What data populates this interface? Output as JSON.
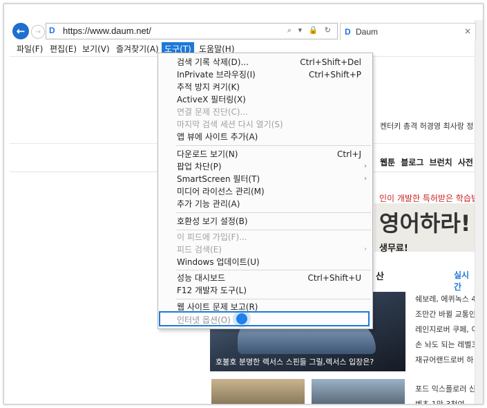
{
  "browser": {
    "url": "https://www.daum.net/",
    "tab_title": "Daum",
    "favicon_letter": "D",
    "url_icons": "⌕ ▾ 🔒 ↻",
    "close_glyph": "×"
  },
  "menubar": [
    {
      "label": "파일(F)"
    },
    {
      "label": "편집(E)"
    },
    {
      "label": "보기(V)"
    },
    {
      "label": "즐겨찾기(A)"
    },
    {
      "label": "도구(T)"
    },
    {
      "label": "도움말(H)"
    }
  ],
  "tools_menu": {
    "items": [
      {
        "label": "검색 기록 삭제(D)...",
        "shortcut": "Ctrl+Shift+Del"
      },
      {
        "label": "InPrivate 브라우징(I)",
        "shortcut": "Ctrl+Shift+P"
      },
      {
        "label": "추적 방지 켜기(K)",
        "shortcut": ""
      },
      {
        "label": "ActiveX 필터링(X)",
        "shortcut": ""
      },
      {
        "label": "연결 문제 진단(C)...",
        "shortcut": ""
      },
      {
        "label": "마지막 검색 세션 다시 열기(S)",
        "shortcut": ""
      },
      {
        "label": "앱 뷰에 사이트 추가(A)",
        "shortcut": ""
      },
      {
        "label": "다운로드 보기(N)",
        "shortcut": "Ctrl+J"
      },
      {
        "label": "팝업 차단(P)",
        "shortcut": ""
      },
      {
        "label": "SmartScreen 필터(T)",
        "shortcut": ""
      },
      {
        "label": "미디어 라이선스 관리(M)",
        "shortcut": ""
      },
      {
        "label": "추가 기능 관리(A)",
        "shortcut": ""
      },
      {
        "label": "호환성 보기 설정(B)",
        "shortcut": ""
      },
      {
        "label": "이 피드에 가입(F)...",
        "shortcut": ""
      },
      {
        "label": "피드 검색(E)",
        "shortcut": ""
      },
      {
        "label": "Windows 업데이트(U)",
        "shortcut": ""
      },
      {
        "label": "성능 대시보드",
        "shortcut": "Ctrl+Shift+U"
      },
      {
        "label": "F12 개발자 도구(L)",
        "shortcut": ""
      },
      {
        "label": "웹 사이트 문제 보고(R)",
        "shortcut": ""
      },
      {
        "label": "인터넷 옵션(O)",
        "shortcut": ""
      }
    ],
    "submenu_arrow": "›"
  },
  "page": {
    "realtime_terms": "켄터키 총격   허경영 최사랑   정",
    "nav_right": "웹툰 블로그 브런치 사전",
    "ad_line1": "인이 개발한 특허받은 학습법",
    "ad_big": "영어하라!",
    "ad_line3": "생무료!",
    "section_title": "산",
    "section_more": "실시간",
    "hero_caption": "호불호 분명한 렉서스 스핀들 그릴,렉서스 입장은?",
    "news": [
      "쉐보레, 에퀴녹스 4",
      "조만간 바뀔 교통인",
      "레인지로버 쿠페, 이",
      "손 놔도 되는 레벨3",
      "재규어랜드로버 하",
      "포드 익스플로러 신",
      "벤츠 1만 3천여"
    ]
  }
}
